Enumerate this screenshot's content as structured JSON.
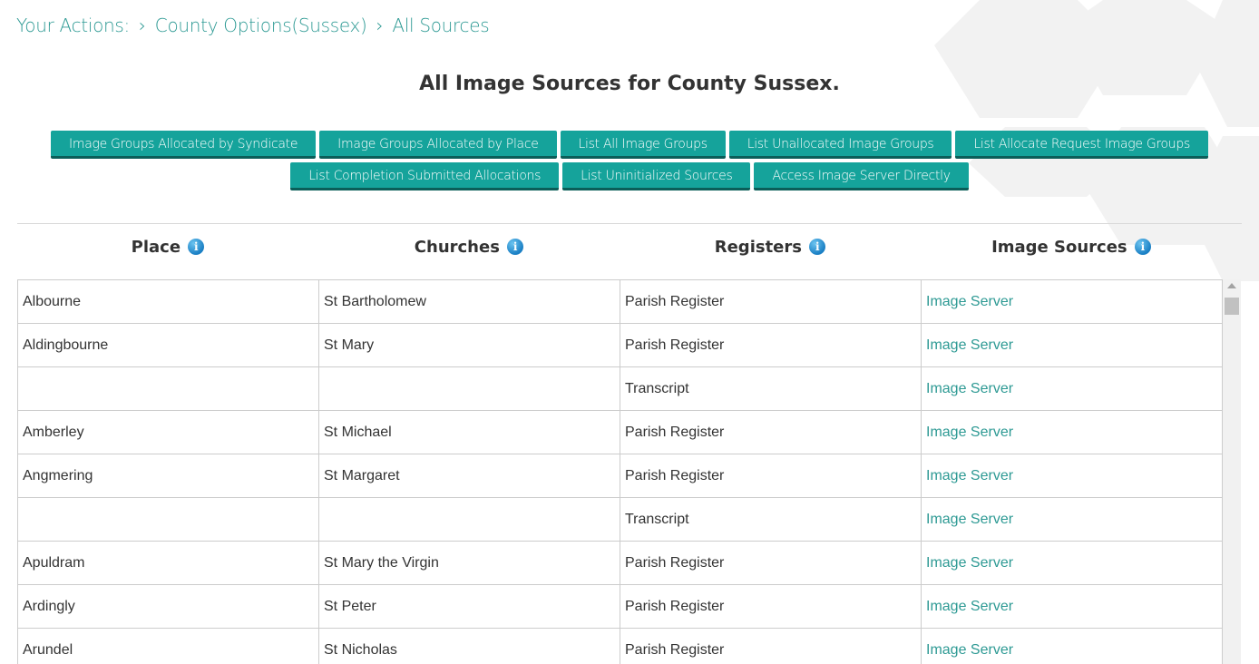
{
  "breadcrumb": {
    "prefix": "Your Actions:",
    "sep": "›",
    "items": [
      "County Options(Sussex)",
      "All Sources"
    ]
  },
  "title": "All Image Sources for County Sussex.",
  "buttons_row1": [
    "Image Groups Allocated by Syndicate",
    "Image Groups Allocated by Place",
    "List All Image Groups",
    "List Unallocated Image Groups",
    "List Allocate Request Image Groups"
  ],
  "buttons_row2": [
    "List Completion Submitted Allocations",
    "List Uninitialized Sources",
    "Access Image Server Directly"
  ],
  "columns": [
    "Place",
    "Churches",
    "Registers",
    "Image Sources"
  ],
  "info_glyph": "i",
  "rows": [
    {
      "place": "Albourne",
      "church": "St Bartholomew",
      "register": "Parish Register",
      "source": "Image Server"
    },
    {
      "place": "Aldingbourne",
      "church": "St Mary",
      "register": "Parish Register",
      "source": "Image Server"
    },
    {
      "place": "",
      "church": "",
      "register": "Transcript",
      "source": "Image Server"
    },
    {
      "place": "Amberley",
      "church": "St Michael",
      "register": "Parish Register",
      "source": "Image Server"
    },
    {
      "place": "Angmering",
      "church": "St Margaret",
      "register": "Parish Register",
      "source": "Image Server"
    },
    {
      "place": "",
      "church": "",
      "register": "Transcript",
      "source": "Image Server"
    },
    {
      "place": "Apuldram",
      "church": "St Mary the Virgin",
      "register": "Parish Register",
      "source": "Image Server"
    },
    {
      "place": "Ardingly",
      "church": "St Peter",
      "register": "Parish Register",
      "source": "Image Server"
    },
    {
      "place": "Arundel",
      "church": "St Nicholas",
      "register": "Parish Register",
      "source": "Image Server"
    }
  ],
  "colors": {
    "accent": "#2e9a94",
    "button": "#15a39b",
    "button_shadow": "#0b5e59",
    "hex": "#f1f1f1"
  }
}
